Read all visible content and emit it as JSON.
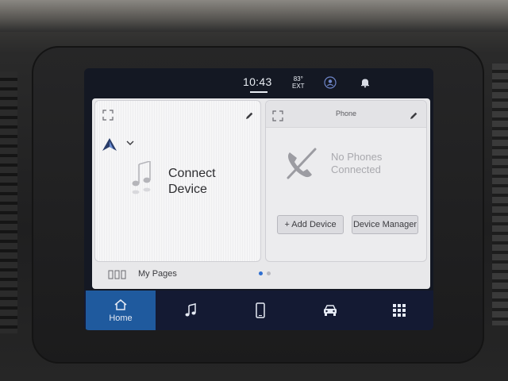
{
  "status": {
    "time": "10:43",
    "temperature": "83°",
    "temperature_label": "EXT",
    "icons": [
      "profile-icon",
      "bell-icon"
    ]
  },
  "left_card": {
    "icons": [
      "expand-icon",
      "edit-icon",
      "android-auto-icon",
      "chevron-down-icon",
      "music-note-icon"
    ],
    "line1": "Connect",
    "line2": "Device"
  },
  "phone_card": {
    "title": "Phone",
    "status_line1": "No Phones",
    "status_line2": "Connected",
    "add_device_label": "+ Add Device",
    "device_manager_label": "Device Manager",
    "icons": [
      "expand-icon",
      "edit-icon",
      "phone-disconnected-icon"
    ]
  },
  "pages": {
    "label": "My Pages",
    "count": 2,
    "active": 1
  },
  "nav": {
    "home_label": "Home",
    "items": [
      "home-icon",
      "media-icon",
      "phone-icon",
      "vehicle-icon",
      "apps-icon"
    ],
    "active": "home"
  },
  "colors": {
    "accent": "#1f5a9e",
    "navbar": "#141a33",
    "dot_active": "#2f6fd1",
    "dot_inactive": "#b9b9c0"
  }
}
